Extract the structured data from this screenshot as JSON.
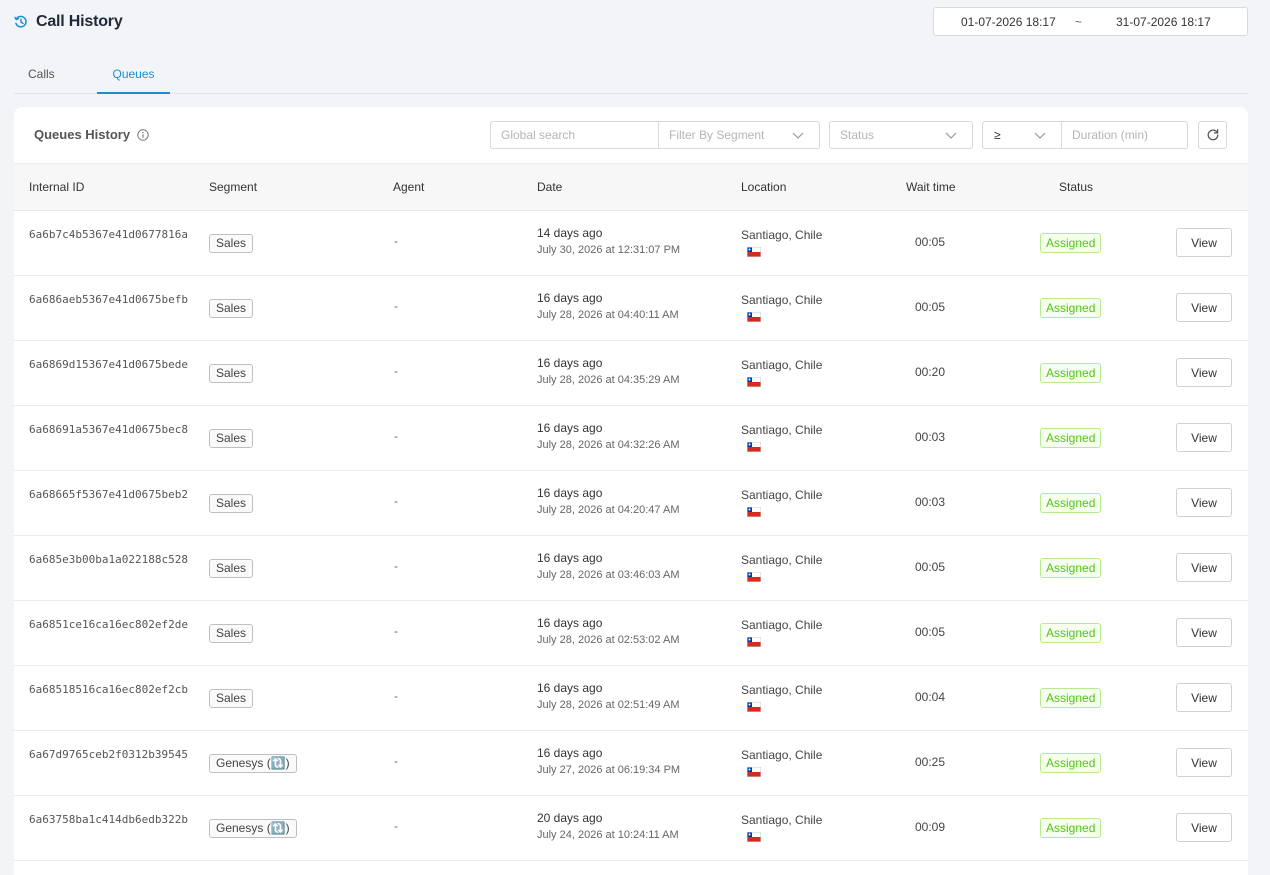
{
  "header": {
    "title": "Call History"
  },
  "date_range": {
    "start": "01-07-2026 18:17",
    "separator": "~",
    "end": "31-07-2026 18:17"
  },
  "tabs": [
    {
      "label": "Calls"
    },
    {
      "label": "Queues"
    }
  ],
  "active_tab": "Queues",
  "card": {
    "title": "Queues History",
    "filters": {
      "search_placeholder": "Global search",
      "segment_placeholder": "Filter By Segment",
      "status_placeholder": "Status",
      "operator_value": "≥",
      "duration_placeholder": "Duration (min)"
    }
  },
  "table": {
    "columns": [
      "Internal ID",
      "Segment",
      "Agent",
      "Date",
      "Location",
      "Wait time",
      "Status"
    ],
    "rows": [
      {
        "id": "6a6b7c4b5367e41d0677816a",
        "segment": "Sales",
        "agent": "-",
        "date_relative": "14 days ago",
        "date_absolute": "July 30, 2026 at 12:31:07 PM",
        "location": "Santiago, Chile",
        "wait": "00:05",
        "status": "Assigned",
        "action": "View"
      },
      {
        "id": "6a686aeb5367e41d0675befb",
        "segment": "Sales",
        "agent": "-",
        "date_relative": "16 days ago",
        "date_absolute": "July 28, 2026 at 04:40:11 AM",
        "location": "Santiago, Chile",
        "wait": "00:05",
        "status": "Assigned",
        "action": "View"
      },
      {
        "id": "6a6869d15367e41d0675bede",
        "segment": "Sales",
        "agent": "-",
        "date_relative": "16 days ago",
        "date_absolute": "July 28, 2026 at 04:35:29 AM",
        "location": "Santiago, Chile",
        "wait": "00:20",
        "status": "Assigned",
        "action": "View"
      },
      {
        "id": "6a68691a5367e41d0675bec8",
        "segment": "Sales",
        "agent": "-",
        "date_relative": "16 days ago",
        "date_absolute": "July 28, 2026 at 04:32:26 AM",
        "location": "Santiago, Chile",
        "wait": "00:03",
        "status": "Assigned",
        "action": "View"
      },
      {
        "id": "6a68665f5367e41d0675beb2",
        "segment": "Sales",
        "agent": "-",
        "date_relative": "16 days ago",
        "date_absolute": "July 28, 2026 at 04:20:47 AM",
        "location": "Santiago, Chile",
        "wait": "00:03",
        "status": "Assigned",
        "action": "View"
      },
      {
        "id": "6a685e3b00ba1a022188c528",
        "segment": "Sales",
        "agent": "-",
        "date_relative": "16 days ago",
        "date_absolute": "July 28, 2026 at 03:46:03 AM",
        "location": "Santiago, Chile",
        "wait": "00:05",
        "status": "Assigned",
        "action": "View"
      },
      {
        "id": "6a6851ce16ca16ec802ef2de",
        "segment": "Sales",
        "agent": "-",
        "date_relative": "16 days ago",
        "date_absolute": "July 28, 2026 at 02:53:02 AM",
        "location": "Santiago, Chile",
        "wait": "00:05",
        "status": "Assigned",
        "action": "View"
      },
      {
        "id": "6a68518516ca16ec802ef2cb",
        "segment": "Sales",
        "agent": "-",
        "date_relative": "16 days ago",
        "date_absolute": "July 28, 2026 at 02:51:49 AM",
        "location": "Santiago, Chile",
        "wait": "00:04",
        "status": "Assigned",
        "action": "View"
      },
      {
        "id": "6a67d9765ceb2f0312b39545",
        "segment": "Genesys (🔃)",
        "agent": "-",
        "date_relative": "16 days ago",
        "date_absolute": "July 27, 2026 at 06:19:34 PM",
        "location": "Santiago, Chile",
        "wait": "00:25",
        "status": "Assigned",
        "action": "View"
      },
      {
        "id": "6a63758ba1c414db6edb322b",
        "segment": "Genesys (🔃)",
        "agent": "-",
        "date_relative": "20 days ago",
        "date_absolute": "July 24, 2026 at 10:24:11 AM",
        "location": "Santiago, Chile",
        "wait": "00:09",
        "status": "Assigned",
        "action": "View"
      }
    ]
  },
  "colors": {
    "accent": "#1890d0",
    "success": "#52c41a",
    "success_bg": "#f6ffed",
    "success_border": "#b7eb8f"
  },
  "icons": {
    "title": "history-icon",
    "info": "info-icon",
    "refresh": "refresh-icon",
    "dropdown": "chevron-down-icon",
    "flag": "chile-flag-icon"
  }
}
